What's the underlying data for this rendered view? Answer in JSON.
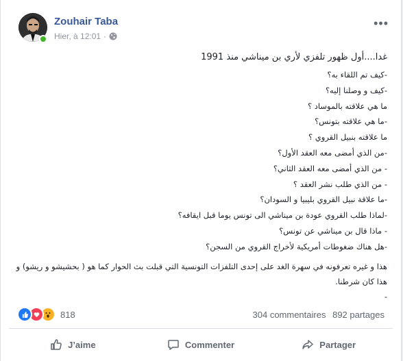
{
  "post": {
    "author": "Zouhair Taba",
    "time": "Hier, à 12:01",
    "dot": "·",
    "first_line": "غدا....أول ظهور تلفزي لأري بن ميناشي منذ 1991",
    "questions": [
      "-كيف تم اللقاء به؟",
      "-كيف و وصلنا إليه؟",
      "ما هي علاقته بالموساد ؟",
      "-ما هي علاقته بتونس؟",
      "ما علاقته بنبيل القروي ؟",
      "-من الذي أمضى معه العقد الأول؟",
      "- من الذي أمضى معه العقد الثاني؟",
      "- من الذي طلب نشر العقد ؟",
      "-ما علاقة نبيل القروي بليبيا و السودان؟",
      "-لماذا طلب القروي عودة بن ميناشي الى تونس يوما قبل ايقافه؟",
      "- ماذا قال بن ميناشي عن تونس؟",
      "-هل هناك ضغوطات أمريكية لأخراج القروي من السجن؟"
    ],
    "closing": "هذا و غيره تعرفونه في سهرة الغد على إحدى التلفزات التونسية التي قبلت بث الحوار كما هو ( بحشيشو و ريشو) و هذا كان شرطنا.",
    "trailing": "-"
  },
  "stats": {
    "reactions_count": "818",
    "comments": "304 commentaires",
    "shares": "892 partages"
  },
  "actions": {
    "like": "J’aime",
    "comment": "Commenter",
    "share": "Partager"
  },
  "icons": [
    "public-globe-icon",
    "more-options-icon",
    "like-reaction-icon",
    "love-reaction-icon",
    "wow-reaction-icon",
    "thumbs-up-icon",
    "comment-icon",
    "share-icon"
  ],
  "colors": {
    "name": "#385898",
    "online": "#42b72a",
    "like": "#2078f4",
    "love": "#f33e58",
    "wow": "#f7b125"
  }
}
